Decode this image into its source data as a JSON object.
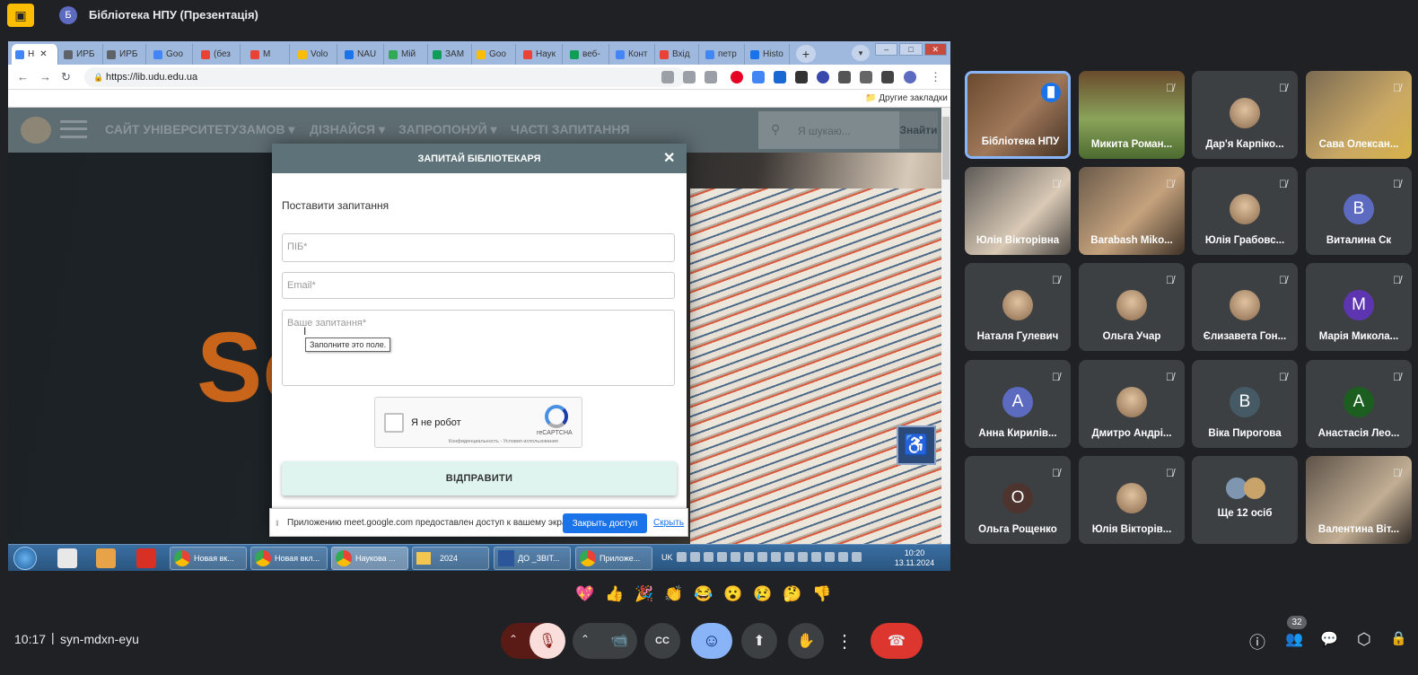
{
  "meet": {
    "presentation_title": "Бібліотека НПУ (Презентація)",
    "presenter_initial": "Б",
    "time": "10:17",
    "separator": "|",
    "meeting_code": "syn-mdxn-eyu",
    "participant_count": "32"
  },
  "browser": {
    "tabs": [
      "Н",
      "ИРБ",
      "ИРБ",
      "Goo",
      "(без",
      "М",
      "Volo",
      "NAU",
      "Мій",
      "ЗАМ",
      "Goo",
      "Наук",
      "веб-",
      "Конт",
      "Вхід",
      "петр",
      "Histo"
    ],
    "url": "https://lib.udu.edu.ua",
    "bookmark_folder": "Другие закладки",
    "new_tab": "+",
    "win_min": "–",
    "win_max": "□",
    "win_close": "✕"
  },
  "site": {
    "nav": [
      "САЙТ УНІВЕРСИТЕТУ",
      "ЗАМОВ ▾",
      "ДІЗНАЙСЯ ▾",
      "ЗАПРОПОНУЙ ▾",
      "ЧАСТІ ЗАПИТАННЯ"
    ],
    "search_placeholder": "Я шукаю...",
    "search_button": "Знайти",
    "hero_text": "Sc"
  },
  "modal": {
    "title": "ЗАПИТАЙ БІБЛІОТЕКАРЯ",
    "close": "✕",
    "subtitle": "Поставити запитання",
    "name_placeholder": "ПІБ*",
    "email_placeholder": "Email*",
    "question_placeholder": "Ваше запитання*",
    "tooltip": "Заполните это поле.",
    "captcha_label": "Я не робот",
    "captcha_brand": "reCAPTCHA",
    "captcha_links": "Конфиденциальность - Условия использования",
    "submit": "ВІДПРАВИТИ"
  },
  "share_notice": {
    "text": "Приложению meet.google.com предоставлен доступ к вашему экрану.",
    "stop": "Закрыть доступ",
    "hide": "Скрыть"
  },
  "taskbar": {
    "items": [
      "Новая вк...",
      "Новая вкл...",
      "Наукова ...",
      "2024",
      "ДО _ЗВІТ...",
      "Приложе..."
    ],
    "lang": "UK",
    "time": "10:20",
    "date": "13.11.2024"
  },
  "participants": [
    {
      "name": "Бібліотека НПУ",
      "kind": "video"
    },
    {
      "name": "Микита Роман...",
      "kind": "video"
    },
    {
      "name": "Дар'я Карпіко...",
      "kind": "photo"
    },
    {
      "name": "Сава Олексан...",
      "kind": "video"
    },
    {
      "name": "Юлія Вікторівна",
      "kind": "video"
    },
    {
      "name": "Barabash Miko...",
      "kind": "video"
    },
    {
      "name": "Юлія Грабовс...",
      "kind": "photo"
    },
    {
      "name": "Виталина Ск",
      "kind": "letter",
      "letter": "В",
      "color": "#5c6bc0"
    },
    {
      "name": "Наталя Гулевич",
      "kind": "photo"
    },
    {
      "name": "Ольга Учар",
      "kind": "photo"
    },
    {
      "name": "Єлизавета Гон...",
      "kind": "photo"
    },
    {
      "name": "Марія Микола...",
      "kind": "letter",
      "letter": "М",
      "color": "#5e35b1"
    },
    {
      "name": "Анна Кирилів...",
      "kind": "letter",
      "letter": "А",
      "color": "#5c6bc0"
    },
    {
      "name": "Дмитро Андрі...",
      "kind": "photo"
    },
    {
      "name": "Віка Пирогова",
      "kind": "letter",
      "letter": "В",
      "color": "#455a64"
    },
    {
      "name": "Анастасія Лео...",
      "kind": "letter",
      "letter": "А",
      "color": "#1b5e20"
    },
    {
      "name": "Ольга Рощенко",
      "kind": "letter",
      "letter": "О",
      "color": "#4e342e"
    },
    {
      "name": "Юлія Вікторів...",
      "kind": "photo"
    },
    {
      "name": "Ще 12 осіб",
      "kind": "more"
    },
    {
      "name": "Валентина Віт...",
      "kind": "video"
    }
  ],
  "reactions": [
    "💖",
    "👍",
    "🎉",
    "👏",
    "😂",
    "😮",
    "😢",
    "🤔",
    "👎"
  ],
  "icons": {
    "mic_off": "🎙",
    "camera": "📹",
    "captions": "CC",
    "emoji": "☺",
    "present": "⬆",
    "hand": "✋",
    "more": "⋮",
    "end": "☎",
    "info": "ⓘ",
    "people": "👥",
    "chat": "💬",
    "activities": "⬡",
    "lock": "🔒",
    "accessibility": "♿"
  }
}
